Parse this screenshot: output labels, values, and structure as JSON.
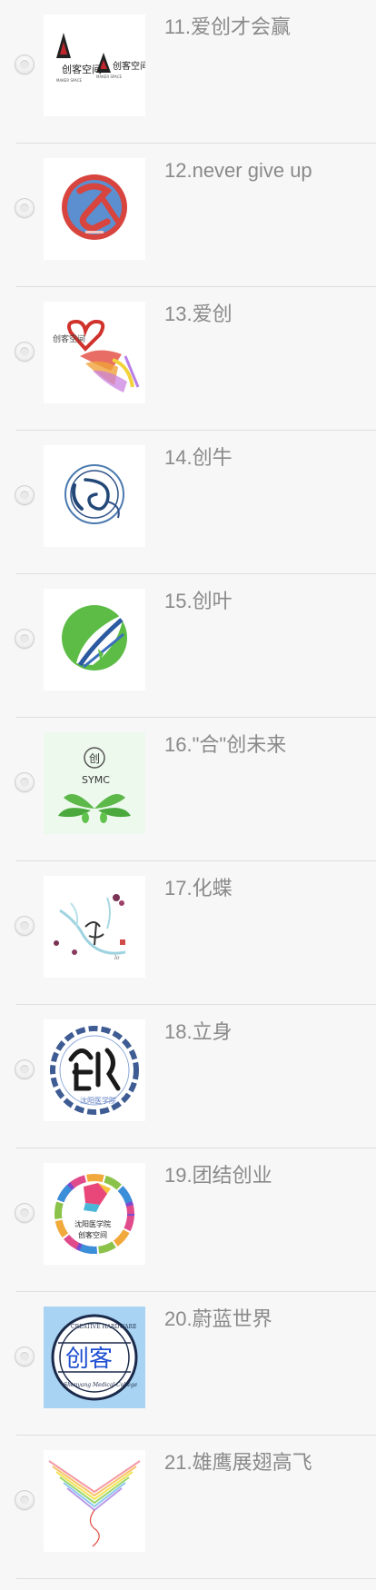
{
  "options": [
    {
      "label": "11.爱创才会赢",
      "logo": "ax-logo-icon",
      "logo_text": "创客空间",
      "logo_text2": "MAKER SPACE"
    },
    {
      "label": "12.never give up",
      "logo": "cs-circle-logo-icon"
    },
    {
      "label": "13.爱创",
      "logo": "heart-swirl-logo-icon",
      "logo_text": "创客空间"
    },
    {
      "label": "14.创牛",
      "logo": "ox-swirl-logo-icon"
    },
    {
      "label": "15.创叶",
      "logo": "leaf-circle-logo-icon"
    },
    {
      "label": "16.\"合\"创未来",
      "logo": "green-leaves-logo-icon",
      "logo_text": "创",
      "logo_text2": "SYMC"
    },
    {
      "label": "17.化蝶",
      "logo": "butterfly-branch-logo-icon"
    },
    {
      "label": "18.立身",
      "logo": "seal-circle-logo-icon",
      "logo_text": "创"
    },
    {
      "label": "19.团结创业",
      "logo": "rainbow-ring-logo-icon",
      "logo_text": "沈阳医学院",
      "logo_text2": "创客空间"
    },
    {
      "label": "20.蔚蓝世界",
      "logo": "blue-stamp-logo-icon",
      "logo_text": "创客"
    },
    {
      "label": "21.雄鹰展翅高飞",
      "logo": "rainbow-wings-logo-icon"
    }
  ]
}
